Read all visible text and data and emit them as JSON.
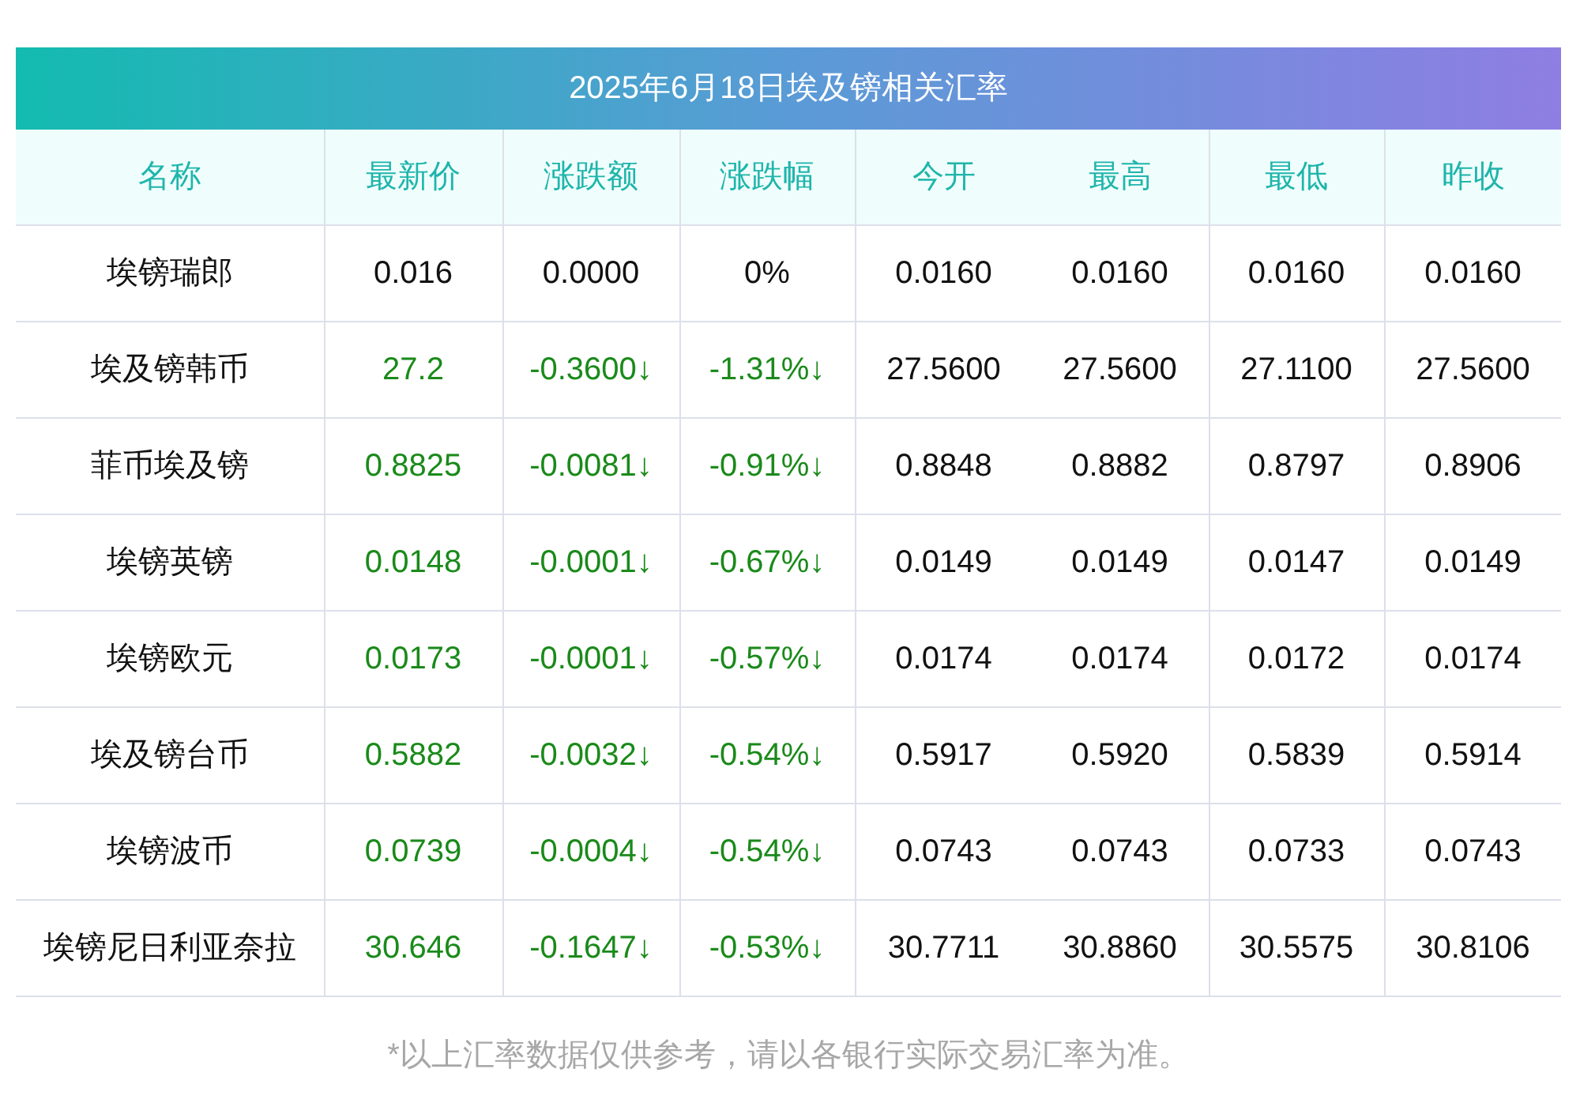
{
  "title": "2025年6月18日埃及镑相关汇率",
  "columns": [
    "名称",
    "最新价",
    "涨跌额",
    "涨跌幅",
    "今开",
    "最高",
    "最低",
    "昨收"
  ],
  "rows": [
    {
      "falling": false,
      "cells": [
        "埃镑瑞郎",
        "0.016",
        "0.0000",
        "0%",
        "0.0160",
        "0.0160",
        "0.0160",
        "0.0160"
      ]
    },
    {
      "falling": true,
      "cells": [
        "埃及镑韩币",
        "27.2",
        "-0.3600↓",
        "-1.31%↓",
        "27.5600",
        "27.5600",
        "27.1100",
        "27.5600"
      ]
    },
    {
      "falling": true,
      "cells": [
        "菲币埃及镑",
        "0.8825",
        "-0.0081↓",
        "-0.91%↓",
        "0.8848",
        "0.8882",
        "0.8797",
        "0.8906"
      ]
    },
    {
      "falling": true,
      "cells": [
        "埃镑英镑",
        "0.0148",
        "-0.0001↓",
        "-0.67%↓",
        "0.0149",
        "0.0149",
        "0.0147",
        "0.0149"
      ]
    },
    {
      "falling": true,
      "cells": [
        "埃镑欧元",
        "0.0173",
        "-0.0001↓",
        "-0.57%↓",
        "0.0174",
        "0.0174",
        "0.0172",
        "0.0174"
      ]
    },
    {
      "falling": true,
      "cells": [
        "埃及镑台币",
        "0.5882",
        "-0.0032↓",
        "-0.54%↓",
        "0.5917",
        "0.5920",
        "0.5839",
        "0.5914"
      ]
    },
    {
      "falling": true,
      "cells": [
        "埃镑波币",
        "0.0739",
        "-0.0004↓",
        "-0.54%↓",
        "0.0743",
        "0.0743",
        "0.0733",
        "0.0743"
      ]
    },
    {
      "falling": true,
      "cells": [
        "埃镑尼日利亚奈拉",
        "30.646",
        "-0.1647↓",
        "-0.53%↓",
        "30.7711",
        "30.8860",
        "30.5575",
        "30.8106"
      ]
    }
  ],
  "footnote": "*以上汇率数据仅供参考，请以各银行实际交易汇率为准。"
}
